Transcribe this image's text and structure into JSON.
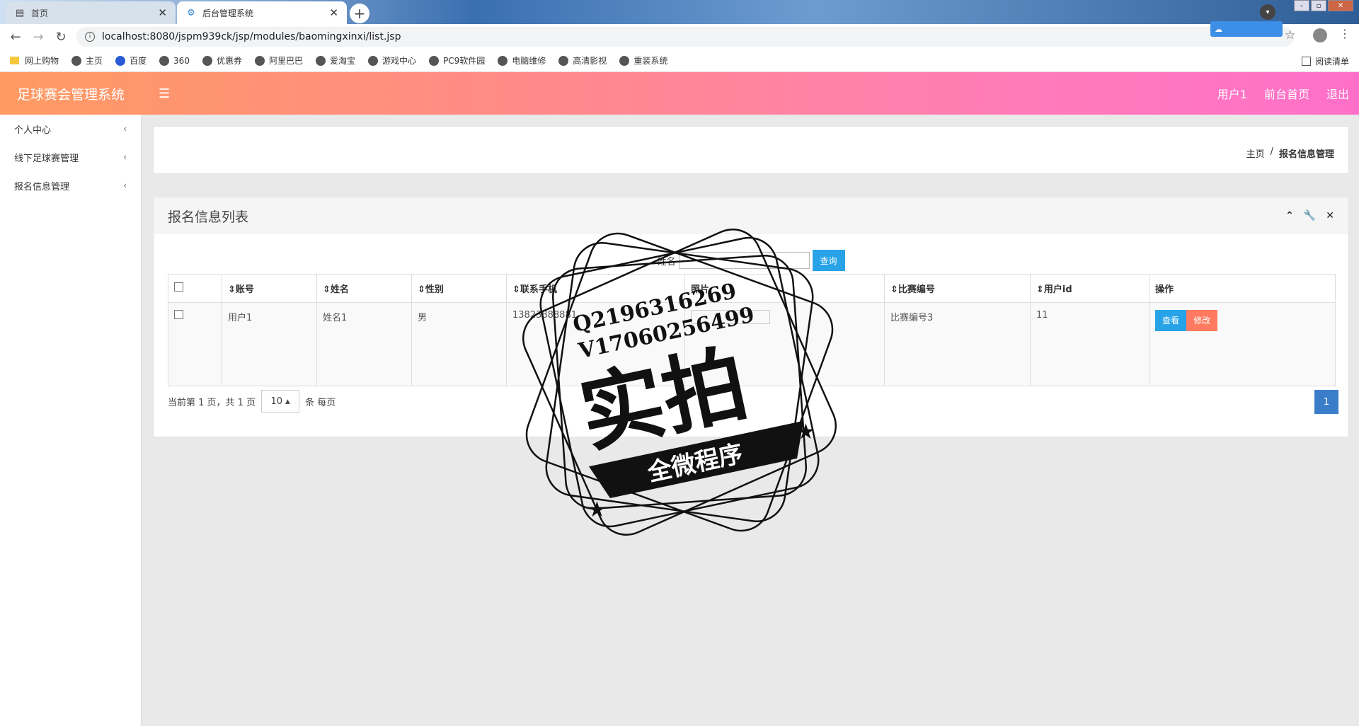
{
  "browser": {
    "tabs": [
      {
        "label": "首页",
        "active": false
      },
      {
        "label": "后台管理系统",
        "active": true
      }
    ],
    "url": "localhost:8080/jspm939ck/jsp/modules/baomingxinxi/list.jsp",
    "bookmarks": [
      "网上购物",
      "主页",
      "百度",
      "360",
      "优惠券",
      "阿里巴巴",
      "爱淘宝",
      "游戏中心",
      "PC9软件园",
      "电脑维修",
      "高清影视",
      "重装系统"
    ],
    "reading_list": "阅读清单"
  },
  "app": {
    "brand": "足球赛会管理系统",
    "topnav": [
      "用户1",
      "前台首页",
      "退出"
    ],
    "sidebar": [
      {
        "label": "个人中心"
      },
      {
        "label": "线下足球赛管理"
      },
      {
        "label": "报名信息管理"
      }
    ],
    "breadcrumb": {
      "home": "主页",
      "sep": "/",
      "current": "报名信息管理"
    },
    "list": {
      "title": "报名信息列表",
      "search_label": "姓名",
      "search_button": "查询",
      "columns": [
        "账号",
        "姓名",
        "性别",
        "联系手机",
        "照片",
        "比赛编号",
        "用户id",
        "操作"
      ],
      "rows": [
        {
          "account": "用户1",
          "name": "姓名1",
          "gender": "男",
          "phone": "13823888881",
          "match_no": "比赛编号3",
          "user_id": "11"
        }
      ],
      "view_button": "查看",
      "edit_button": "修改",
      "pager_text": "当前第 1 页，共 1 页",
      "page_size": "10",
      "per_page_text": "条 每页",
      "page_number": "1"
    }
  },
  "watermark": {
    "line1": "Q2196316269",
    "line2": "V17060256499",
    "big": "实拍",
    "banner": "全微程序"
  }
}
